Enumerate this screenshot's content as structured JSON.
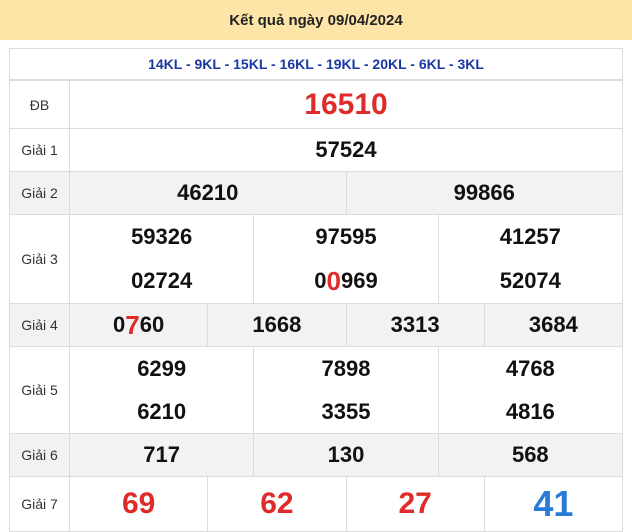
{
  "header": {
    "title": "Kết quả ngày 09/04/2024"
  },
  "codes": "14KL - 9KL - 15KL - 16KL - 19KL - 20KL - 6KL - 3KL",
  "labels": {
    "db": "ĐB",
    "g1": "Giải 1",
    "g2": "Giải 2",
    "g3": "Giải 3",
    "g4": "Giải 4",
    "g5": "Giải 5",
    "g6": "Giải 6",
    "g7": "Giải 7"
  },
  "prizes": {
    "db": "16510",
    "g1": "57524",
    "g2": [
      "46210",
      "99866"
    ],
    "g3_row1": [
      "59326",
      "97595",
      "41257"
    ],
    "g3_row2": [
      "02724",
      "00969",
      "52074"
    ],
    "g4": [
      "0760",
      "1668",
      "3313",
      "3684"
    ],
    "g5_row1": [
      "6299",
      "7898",
      "4768"
    ],
    "g5_row2": [
      "6210",
      "3355",
      "4816"
    ],
    "g6": [
      "717",
      "130",
      "568"
    ],
    "g7": [
      "69",
      "62",
      "27",
      "41"
    ]
  },
  "highlights": {
    "g3_row2_1": {
      "pre": "0",
      "hi": "0",
      "post": "969"
    },
    "g4_0": {
      "pre": "0",
      "hi": "7",
      "post": "60"
    }
  },
  "colors": {
    "red": "#e02b2b",
    "blue": "#2a7bd6",
    "header_bg": "#fde5a7",
    "codes": "#1a37a3"
  }
}
